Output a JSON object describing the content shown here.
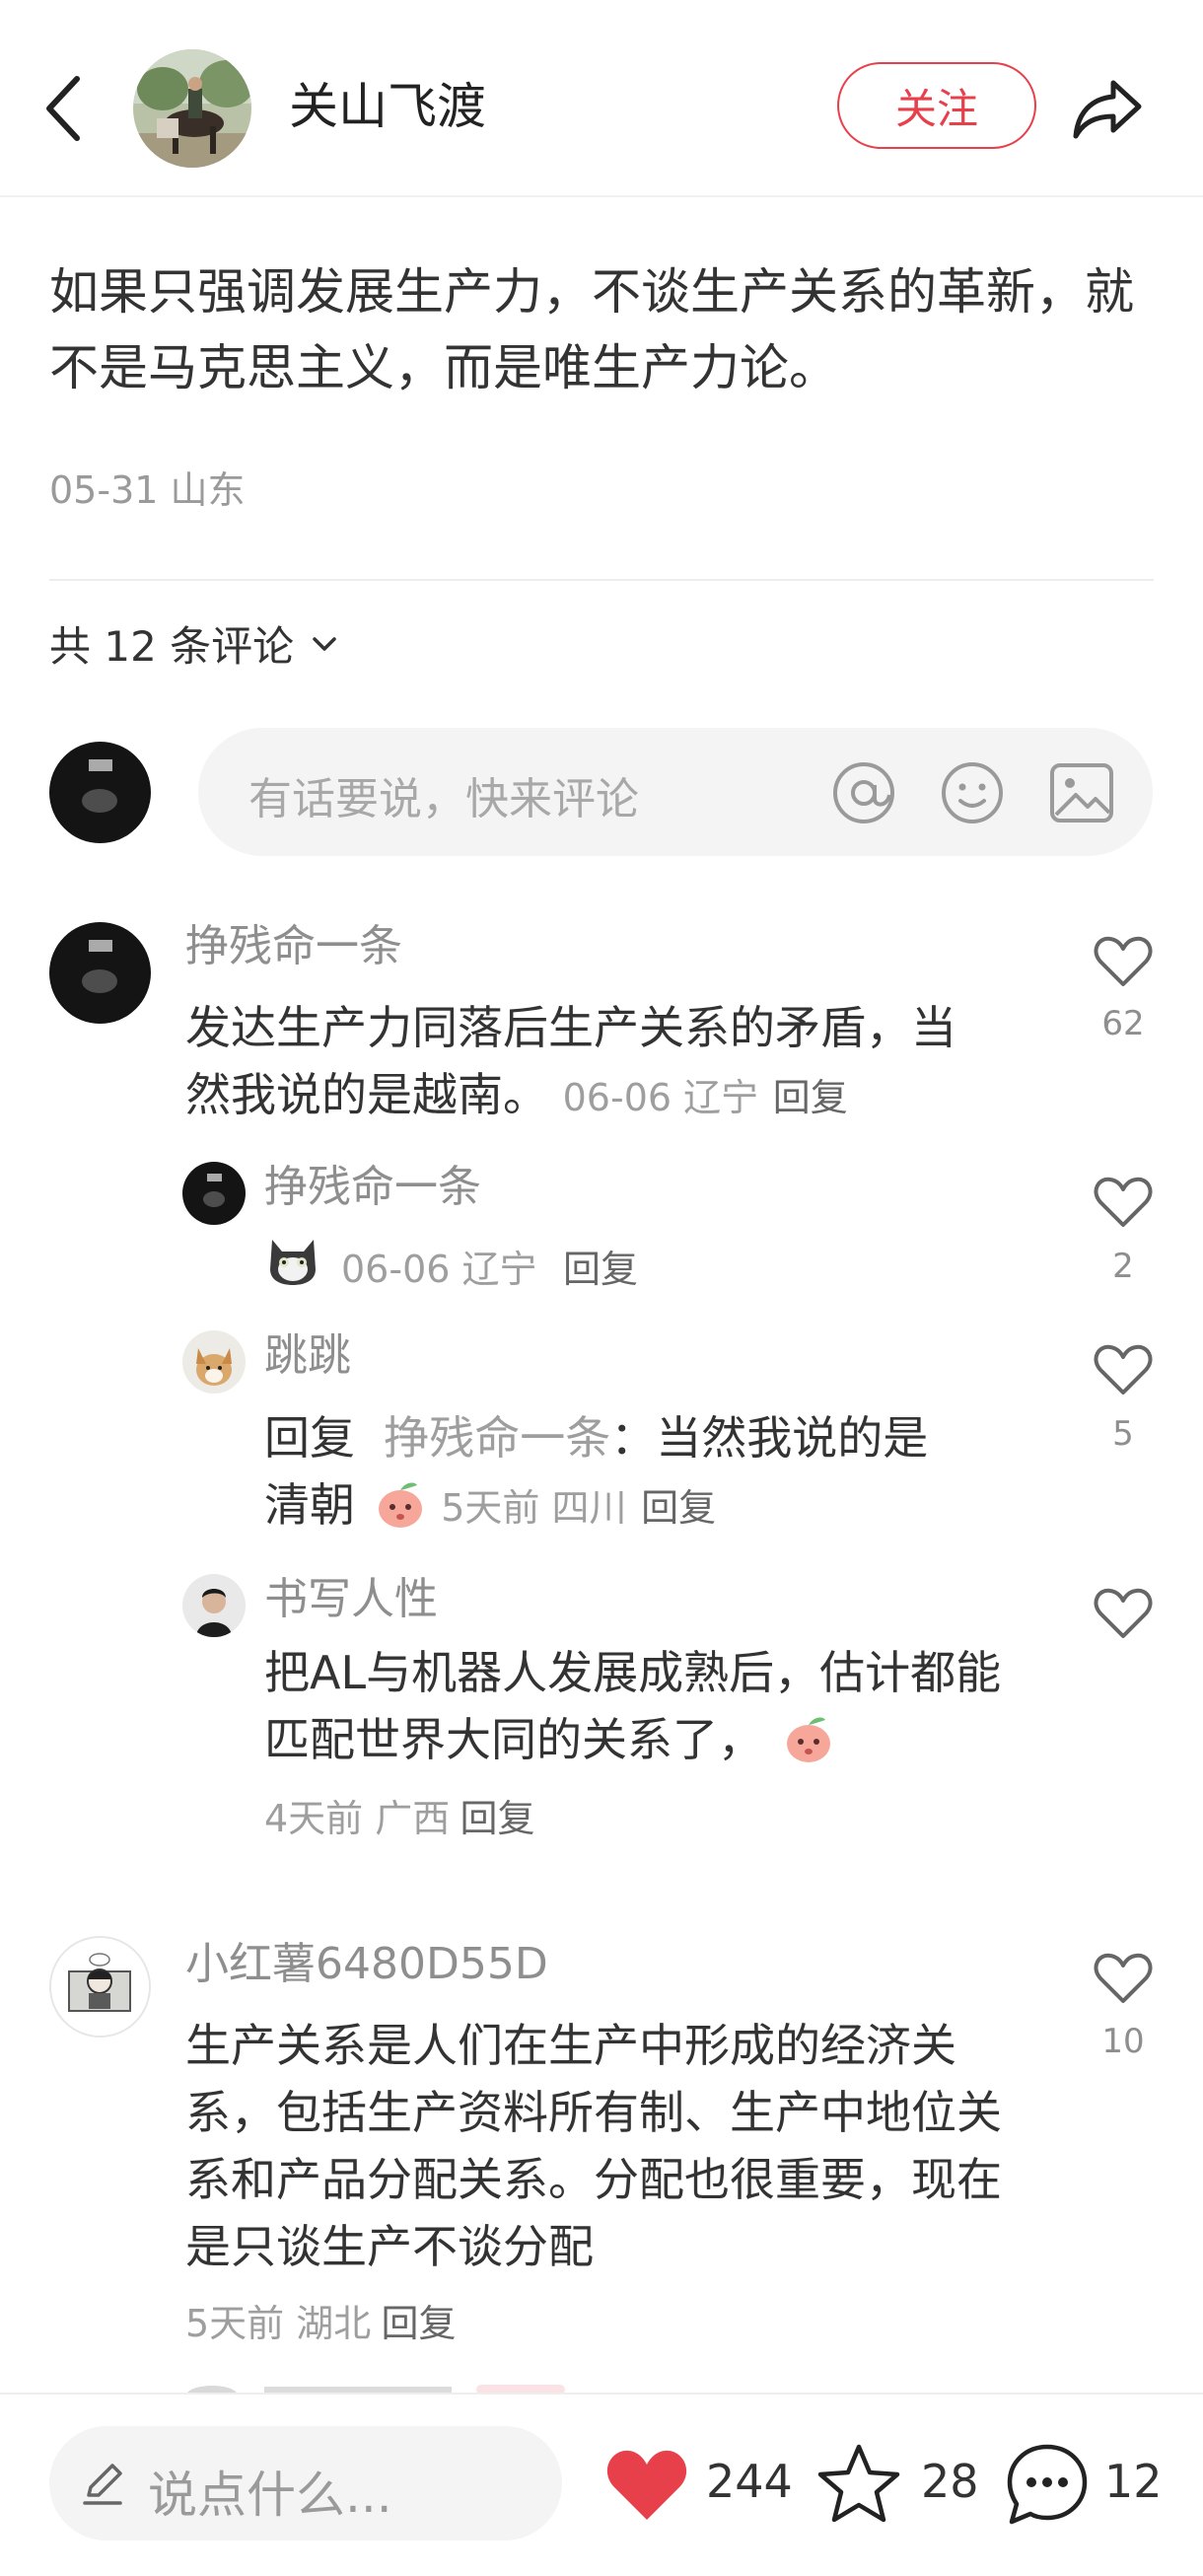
{
  "header": {
    "author_name": "关山飞渡",
    "follow_label": "关注"
  },
  "post": {
    "text": "如果只强调发展生产力，不谈生产关系的革新，就不是马克思主义，而是唯生产力论。",
    "meta": "05-31 山东"
  },
  "comments_header": {
    "count_label": "共 12 条评论"
  },
  "comment_input": {
    "placeholder": "有话要说，快来评论"
  },
  "comments": [
    {
      "author": "挣残命一条",
      "text": "发达生产力同落后生产关系的矛盾，当然我说的是越南。",
      "meta": "06-06 辽宁",
      "reply": "回复",
      "likes": "62",
      "replies": [
        {
          "author": "挣残命一条",
          "meta": "06-06 辽宁",
          "reply": "回复",
          "likes": "2"
        },
        {
          "author": "跳跳",
          "reply_prefix": "回复",
          "reply_to": "挣残命一条",
          "text_after": "：当然我说的是",
          "text_line2": "清朝",
          "meta": "5天前 四川",
          "reply": "回复",
          "likes": "5"
        },
        {
          "author": "书写人性",
          "text": "把AL与机器人发展成熟后，估计都能匹配世界大同的关系了，",
          "meta": "4天前 广西",
          "reply": "回复",
          "likes": ""
        }
      ]
    },
    {
      "author": "小红薯6480D55D",
      "text": "生产关系是人们在生产中形成的经济关系，包括生产资料所有制、生产中地位关系和产品分配关系。分配也很重要，现在是只谈生产不谈分配",
      "meta": "5天前 湖北",
      "reply": "回复",
      "likes": "10"
    }
  ],
  "bottom_bar": {
    "placeholder": "说点什么...",
    "likes": "244",
    "stars": "28",
    "comments": "12"
  },
  "colors": {
    "accent": "#e8404b",
    "like_red": "#e8404b",
    "muted": "#9a9a9a"
  },
  "icons": [
    "back-icon",
    "share-icon",
    "at-icon",
    "emoji-icon",
    "image-icon",
    "heart-icon",
    "star-icon",
    "comment-icon",
    "pencil-icon"
  ]
}
